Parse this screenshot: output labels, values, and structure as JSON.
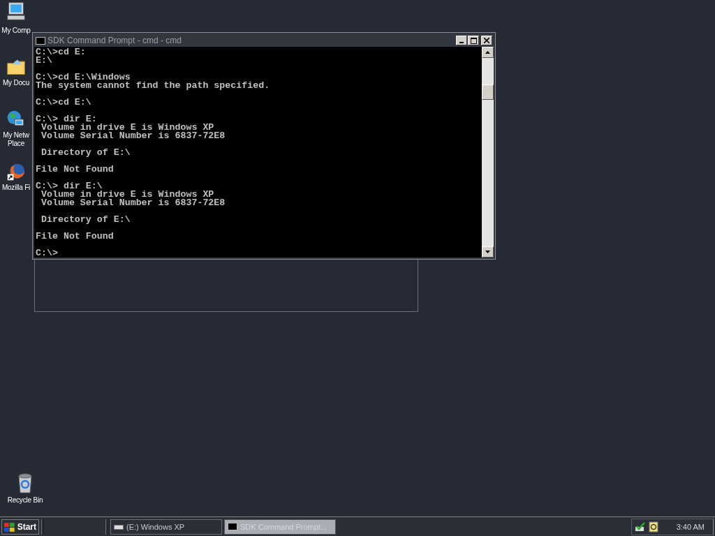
{
  "desktop_icons": [
    {
      "kind": "computer",
      "label": "My Comp"
    },
    {
      "kind": "documents",
      "label": "My Docu"
    },
    {
      "kind": "network",
      "label": "My Netw\nPlace"
    },
    {
      "kind": "browser",
      "label": "Mozilla Fi"
    }
  ],
  "recycle_bin": {
    "label": "Recycle Bin"
  },
  "window": {
    "title": "SDK Command Prompt - cmd - cmd",
    "console_blocks": [
      [
        "C:\\>cd E:",
        "E:\\"
      ],
      [
        "C:\\>cd E:\\Windows",
        "The system cannot find the path specified."
      ],
      [
        "C:\\>cd E:\\"
      ],
      [
        "C:\\> dir E:",
        " Volume in drive E is Windows XP",
        " Volume Serial Number is 6837-72E8"
      ],
      [
        " Directory of E:\\"
      ],
      [
        "File Not Found"
      ],
      [
        "C:\\> dir E:\\",
        " Volume in drive E is Windows XP",
        " Volume Serial Number is 6837-72E8"
      ],
      [
        " Directory of E:\\"
      ],
      [
        "File Not Found"
      ],
      [
        "C:\\>"
      ]
    ]
  },
  "taskbar": {
    "start": "Start",
    "tasks": [
      {
        "kind": "drive",
        "label": "(E:) Windows XP",
        "selected": false
      },
      {
        "kind": "console",
        "label": "SDK Command Prompt...",
        "selected": true
      }
    ],
    "clock": "3:40 AM"
  }
}
